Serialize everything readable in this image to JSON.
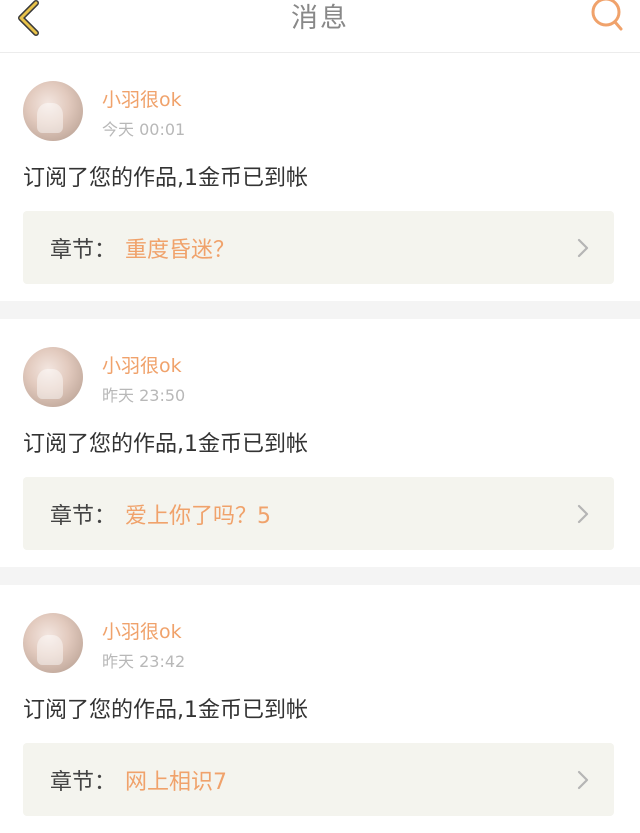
{
  "header": {
    "title": "消息",
    "back_icon": "chevron-left-icon",
    "search_icon": "search-icon"
  },
  "colors": {
    "accent": "#f0a26b",
    "text": "#333333",
    "muted": "#b8b8b8",
    "chapter_bg": "#f4f4ee",
    "back_icon": "#e8c24a"
  },
  "messages": [
    {
      "username": "小羽很ok",
      "time": "今天 00:01",
      "text": "订阅了您的作品,1金币已到帐",
      "chapter_label": "章节：",
      "chapter_title": "重度昏迷？"
    },
    {
      "username": "小羽很ok",
      "time": "昨天 23:50",
      "text": "订阅了您的作品,1金币已到帐",
      "chapter_label": "章节：",
      "chapter_title": "爱上你了吗？5"
    },
    {
      "username": "小羽很ok",
      "time": "昨天 23:42",
      "text": "订阅了您的作品,1金币已到帐",
      "chapter_label": "章节：",
      "chapter_title": "网上相识7"
    }
  ]
}
